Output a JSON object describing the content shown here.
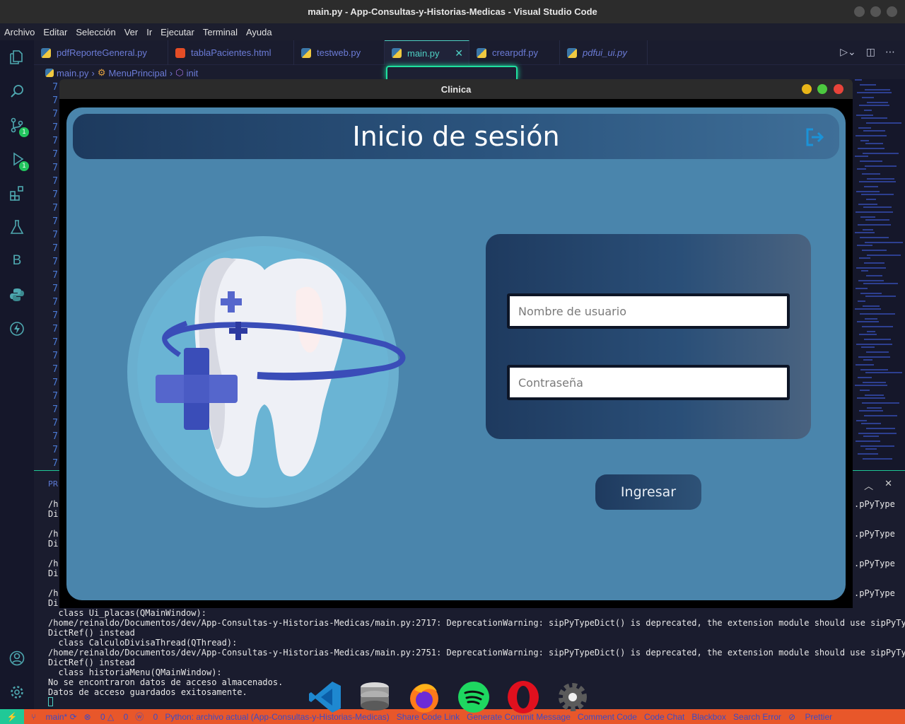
{
  "os_window": {
    "title": "main.py - App-Consultas-y-Historias-Medicas - Visual Studio Code"
  },
  "menu": [
    "Archivo",
    "Editar",
    "Selección",
    "Ver",
    "Ir",
    "Ejecutar",
    "Terminal",
    "Ayuda"
  ],
  "activity_badges": {
    "source_control": "1",
    "run_debug": "1"
  },
  "tabs": [
    {
      "label": "pdfReporteGeneral.py"
    },
    {
      "label": "tablaPacientes.html"
    },
    {
      "label": "testweb.py"
    },
    {
      "label": "main.py",
      "active": true
    },
    {
      "label": "crearpdf.py"
    },
    {
      "label": "pdfui_ui.py"
    }
  ],
  "breadcrumb": {
    "file": "main.py",
    "class": "MenuPrincipal",
    "method": "init"
  },
  "gutter_digit": "7",
  "panel": {
    "prefix": "PR"
  },
  "terminal": {
    "partial_lines": [
      "/h",
      "Di",
      "/h",
      "Di",
      "/h",
      "Di",
      "/h",
      "Di"
    ],
    "right_fragment": ".pPyType",
    "lines": [
      "  class Ui_placas(QMainWindow):",
      "/home/reinaldo/Documentos/dev/App-Consultas-y-Historias-Medicas/main.py:2717: DeprecationWarning: sipPyTypeDict() is deprecated, the extension module should use sipPyType",
      "DictRef() instead",
      "  class CalculoDivisaThread(QThread):",
      "/home/reinaldo/Documentos/dev/App-Consultas-y-Historias-Medicas/main.py:2751: DeprecationWarning: sipPyTypeDict() is deprecated, the extension module should use sipPyType",
      "DictRef() instead",
      "  class historiaMenu(QMainWindow):",
      "No se encontraron datos de acceso almacenados.",
      "Datos de acceso guardados exitosamente."
    ]
  },
  "statusbar": {
    "branch": "main*",
    "errors": "0",
    "warnings": "0",
    "info": "0",
    "python": "Python: archivo actual (App-Consultas-y-Historias-Medicas)",
    "items": [
      "Share Code Link",
      "Generate Commit Message",
      "Comment Code",
      "Code Chat",
      "Blackbox",
      "Search Error"
    ],
    "prettier": "Prettier"
  },
  "dock": [
    "vscode-icon",
    "database-icon",
    "firefox-icon",
    "spotify-icon",
    "opera-icon",
    "settings-icon"
  ],
  "app": {
    "window_title": "Clinica",
    "header_title": "Inicio de sesión",
    "username_placeholder": "Nombre de usuario",
    "password_placeholder": "Contraseña",
    "login_button": "Ingresar"
  }
}
